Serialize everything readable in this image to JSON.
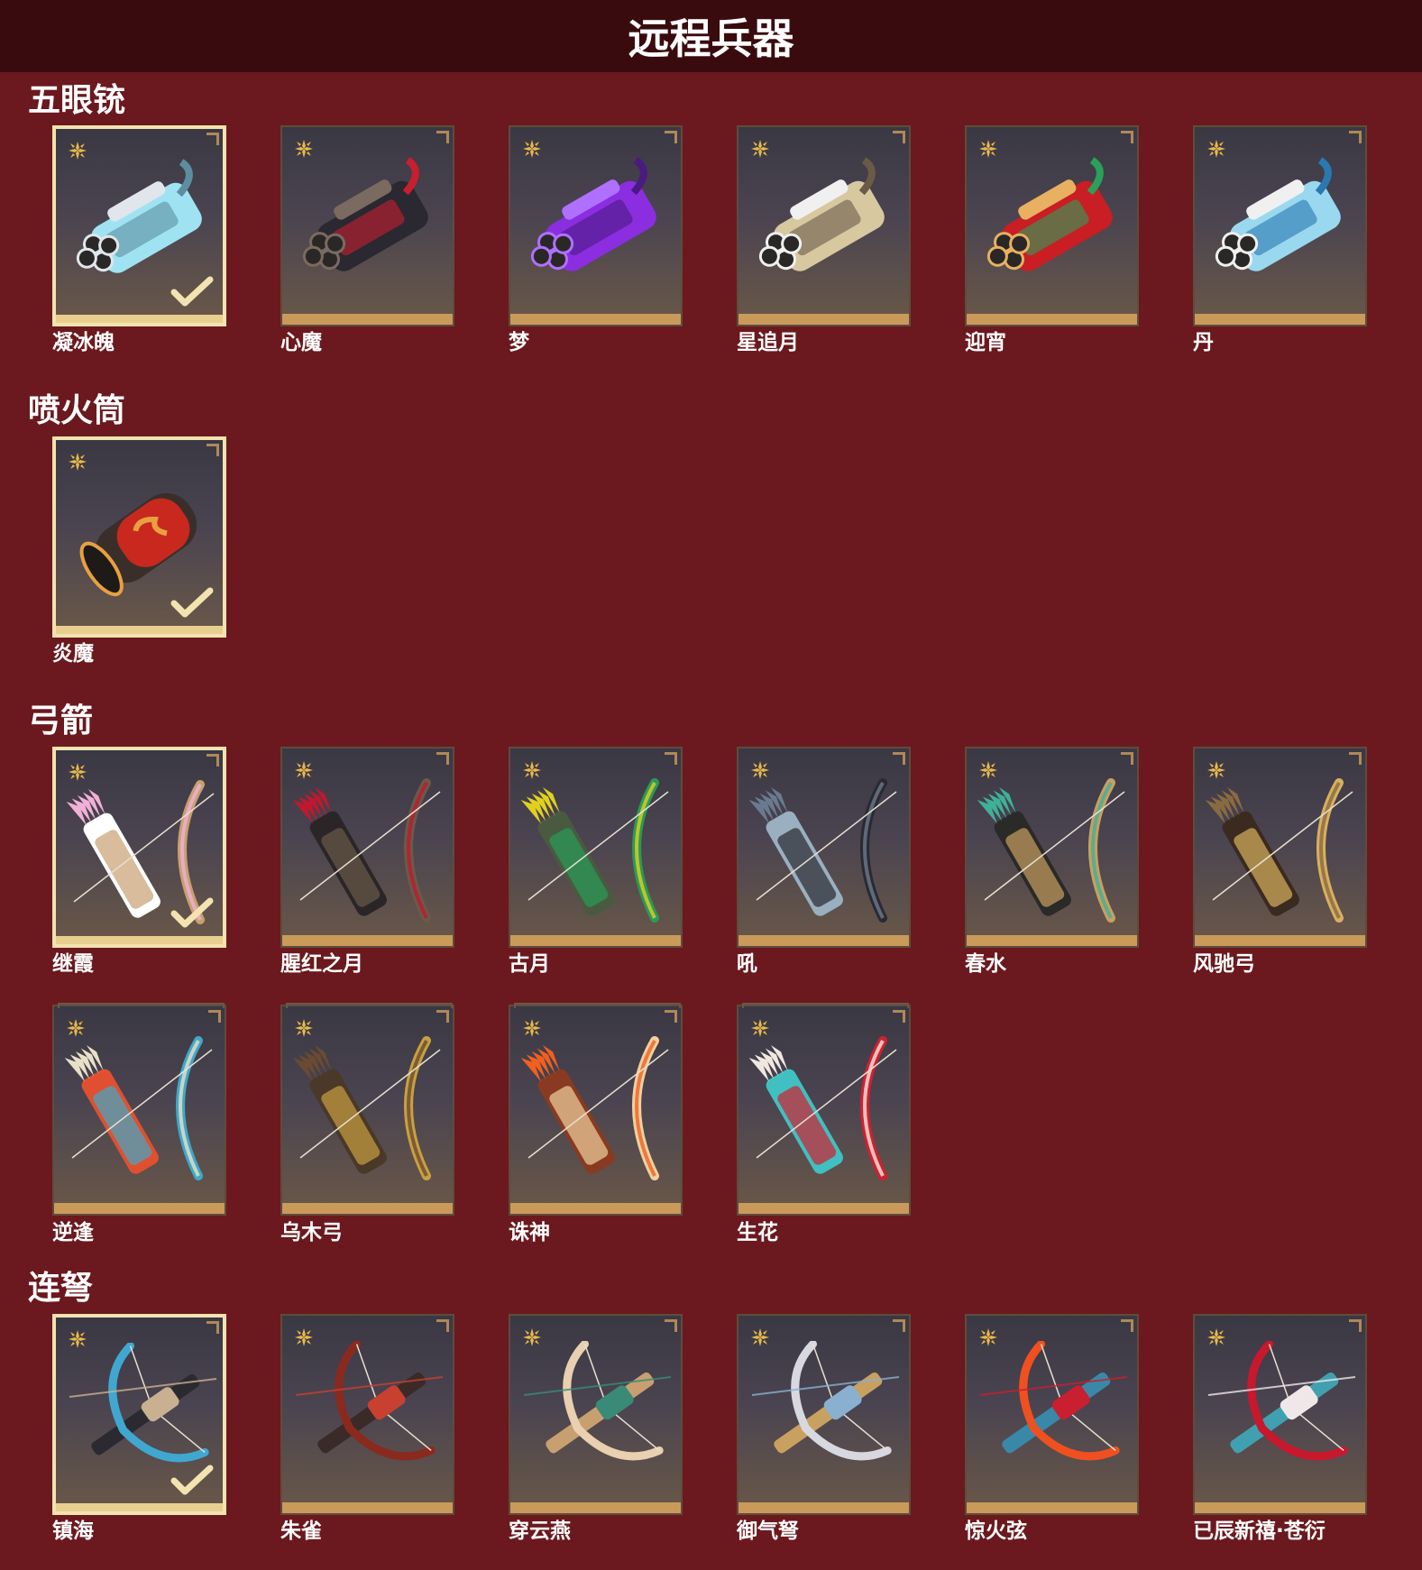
{
  "header": {
    "title": "远程兵器"
  },
  "colors": {
    "background": "#6b191e",
    "header_bg": "#3a0b0e",
    "selected_border": "#f3e3b0",
    "card_bottom": "#c99a5a",
    "rarity_star": "#e8b84a"
  },
  "sections": [
    {
      "title": "五眼铳",
      "items": [
        {
          "name": "凝冰魄",
          "selected": true,
          "art": "ice-gatling",
          "colors": [
            "#9fe3f2",
            "#5c8ea0",
            "#e0e6ec"
          ]
        },
        {
          "name": "心魔",
          "selected": false,
          "art": "demon-gatling",
          "colors": [
            "#2a2830",
            "#c81e30",
            "#7a6a60"
          ]
        },
        {
          "name": "梦",
          "selected": false,
          "art": "purple-gatling",
          "colors": [
            "#8a2ee0",
            "#4a1a80",
            "#b070ff"
          ]
        },
        {
          "name": "星追月",
          "selected": false,
          "art": "gold-gatling",
          "colors": [
            "#d8c8a0",
            "#6a5a48",
            "#f0f0f0"
          ]
        },
        {
          "name": "迎宵",
          "selected": false,
          "art": "red-gatling",
          "colors": [
            "#c81e24",
            "#2aa05a",
            "#e8b060"
          ]
        },
        {
          "name": "丹",
          "selected": false,
          "art": "blue-gatling",
          "colors": [
            "#9ad8f0",
            "#2a78b0",
            "#f0f0f0"
          ]
        }
      ]
    },
    {
      "title": "喷火筒",
      "items": [
        {
          "name": "炎魔",
          "selected": true,
          "art": "flame-cannon",
          "colors": [
            "#c8281e",
            "#e8a040",
            "#3a2e2a"
          ]
        }
      ]
    },
    {
      "title": "弓箭",
      "items": [
        {
          "name": "继霞",
          "selected": true,
          "art": "pink-bow",
          "colors": [
            "#f0b0d8",
            "#c8a070",
            "#ffffff"
          ]
        },
        {
          "name": "腥红之月",
          "selected": false,
          "art": "crimson-bow",
          "colors": [
            "#c0182e",
            "#6a5a48",
            "#2a2628"
          ]
        },
        {
          "name": "古月",
          "selected": false,
          "art": "jade-bow",
          "colors": [
            "#e0d020",
            "#2a9a58",
            "#4a5a40"
          ]
        },
        {
          "name": "吼",
          "selected": false,
          "art": "storm-bow",
          "colors": [
            "#6a7a90",
            "#2a2a30",
            "#9ab0c0"
          ]
        },
        {
          "name": "春水",
          "selected": false,
          "art": "spring-bow",
          "colors": [
            "#40b098",
            "#c8a060",
            "#2a2a28"
          ]
        },
        {
          "name": "风驰弓",
          "selected": false,
          "art": "wind-bow",
          "colors": [
            "#8a6a40",
            "#d8b060",
            "#3a2a20"
          ]
        },
        {
          "name": "逆逢",
          "selected": false,
          "art": "phoenix-bow",
          "colors": [
            "#e8e0c8",
            "#40a8c8",
            "#e05030"
          ]
        },
        {
          "name": "乌木弓",
          "selected": false,
          "art": "ebony-bow",
          "colors": [
            "#6a4a30",
            "#c8a040",
            "#4a3828"
          ]
        },
        {
          "name": "诛神",
          "selected": false,
          "art": "fire-bow",
          "colors": [
            "#f06020",
            "#f0d0a0",
            "#8a3a20"
          ]
        },
        {
          "name": "生花",
          "selected": false,
          "art": "blossom-bow",
          "colors": [
            "#f0e8e0",
            "#d02030",
            "#40c0c0"
          ]
        }
      ]
    },
    {
      "title": "连弩",
      "items": [
        {
          "name": "镇海",
          "selected": true,
          "art": "sea-crossbow",
          "colors": [
            "#40a8d0",
            "#c8b090",
            "#2a2a30"
          ]
        },
        {
          "name": "朱雀",
          "selected": false,
          "art": "vermilion-crossbow",
          "colors": [
            "#8a2a1e",
            "#c84030",
            "#3a2a28"
          ]
        },
        {
          "name": "穿云燕",
          "selected": false,
          "art": "swallow-crossbow",
          "colors": [
            "#e8d0b0",
            "#3a8a78",
            "#c8a070"
          ]
        },
        {
          "name": "御气弩",
          "selected": false,
          "art": "silver-crossbow",
          "colors": [
            "#d8d8e0",
            "#8ab0d0",
            "#c8a060"
          ]
        },
        {
          "name": "惊火弦",
          "selected": false,
          "art": "inferno-crossbow",
          "colors": [
            "#f05020",
            "#c82030",
            "#3a88a8"
          ]
        },
        {
          "name": "已辰新禧·苍衍",
          "selected": false,
          "art": "dragon-crossbow",
          "colors": [
            "#c8182e",
            "#f0e8e8",
            "#40a0b0"
          ]
        }
      ]
    }
  ]
}
